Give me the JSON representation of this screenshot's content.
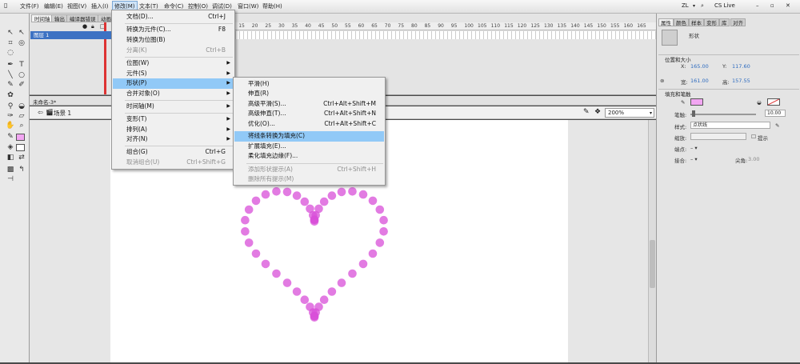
{
  "menubar": {
    "items": [
      "文件(F)",
      "编辑(E)",
      "视图(V)",
      "插入(I)",
      "修改(M)",
      "文本(T)",
      "命令(C)",
      "控制(O)",
      "调试(D)",
      "窗口(W)",
      "帮助(H)"
    ],
    "user": "ZL",
    "cs_live": "CS Live"
  },
  "timeline": {
    "tabs": [
      "时间轴",
      "输出",
      "编译器错误",
      "动画"
    ],
    "layer_name": "图层 1",
    "ruler_numbers": [
      "5",
      "10",
      "15",
      "20",
      "25",
      "30",
      "35",
      "40",
      "45",
      "50",
      "55",
      "60",
      "65",
      "70",
      "75",
      "80",
      "85",
      "90",
      "95",
      "100",
      "105",
      "110",
      "115",
      "120",
      "125",
      "130",
      "135",
      "140",
      "145",
      "150",
      "155",
      "160",
      "165"
    ]
  },
  "document": {
    "tab": "未命名-3*",
    "scene": "场景 1",
    "zoom": "200%"
  },
  "modify_menu": {
    "items": [
      {
        "label": "文档(D)...",
        "shortcut": "Ctrl+J",
        "disabled": false
      },
      {
        "label": "转换为元件(C)...",
        "shortcut": "F8",
        "disabled": false
      },
      {
        "label": "转换为位图(B)",
        "shortcut": "",
        "disabled": false
      },
      {
        "label": "分离(K)",
        "shortcut": "Ctrl+B",
        "disabled": true
      },
      {
        "label": "位图(W)",
        "shortcut": "",
        "disabled": false,
        "submenu": true
      },
      {
        "label": "元件(S)",
        "shortcut": "",
        "disabled": false,
        "submenu": true
      },
      {
        "label": "形状(P)",
        "shortcut": "",
        "disabled": false,
        "submenu": true,
        "highlight": true
      },
      {
        "label": "合并对象(O)",
        "shortcut": "",
        "disabled": false,
        "submenu": true
      },
      {
        "label": "时间轴(M)",
        "shortcut": "",
        "disabled": false,
        "submenu": true
      },
      {
        "label": "变形(T)",
        "shortcut": "",
        "disabled": false,
        "submenu": true
      },
      {
        "label": "排列(A)",
        "shortcut": "",
        "disabled": false,
        "submenu": true
      },
      {
        "label": "对齐(N)",
        "shortcut": "",
        "disabled": false,
        "submenu": true
      },
      {
        "label": "组合(G)",
        "shortcut": "Ctrl+G",
        "disabled": false
      },
      {
        "label": "取消组合(U)",
        "shortcut": "Ctrl+Shift+G",
        "disabled": true
      }
    ]
  },
  "shape_menu": {
    "items": [
      {
        "label": "平滑(H)",
        "shortcut": "",
        "disabled": false
      },
      {
        "label": "伸直(R)",
        "shortcut": "",
        "disabled": false
      },
      {
        "label": "高级平滑(S)...",
        "shortcut": "Ctrl+Alt+Shift+M",
        "disabled": false
      },
      {
        "label": "高级伸直(T)...",
        "shortcut": "Ctrl+Alt+Shift+N",
        "disabled": false
      },
      {
        "label": "优化(O)...",
        "shortcut": "Ctrl+Alt+Shift+C",
        "disabled": false
      },
      {
        "label": "将线条转换为填充(C)",
        "shortcut": "",
        "disabled": false,
        "highlight": true
      },
      {
        "label": "扩展填充(E)...",
        "shortcut": "",
        "disabled": false
      },
      {
        "label": "柔化填充边缘(F)...",
        "shortcut": "",
        "disabled": false
      },
      {
        "label": "添加形状提示(A)",
        "shortcut": "Ctrl+Shift+H",
        "disabled": true
      },
      {
        "label": "删除所有提示(M)",
        "shortcut": "",
        "disabled": true
      }
    ]
  },
  "properties": {
    "tabs": [
      "属性",
      "颜色",
      "样本",
      "变形",
      "库",
      "对齐"
    ],
    "object_type": "形状",
    "section_position": "位置和大小",
    "x_label": "X:",
    "x_value": "165.00",
    "y_label": "Y:",
    "y_value": "117.60",
    "w_label": "宽:",
    "w_value": "161.00",
    "h_label": "高:",
    "h_value": "157.55",
    "section_fill_stroke": "填充和笔触",
    "stroke_label": "笔触:",
    "stroke_value": "10.00",
    "style_label": "样式:",
    "style_value": "点状线",
    "scale_label": "缩放:",
    "hint_label": "提示",
    "cap_label": "端点:",
    "join_label": "接合:",
    "miter_label": "尖角:",
    "miter_value": "3.00",
    "stroke_color": "#f2a6f2",
    "fill_color": "#ffffff"
  },
  "colors": {
    "heart_dots": "#d84fd8",
    "menu_highlight": "#91c9f7"
  }
}
